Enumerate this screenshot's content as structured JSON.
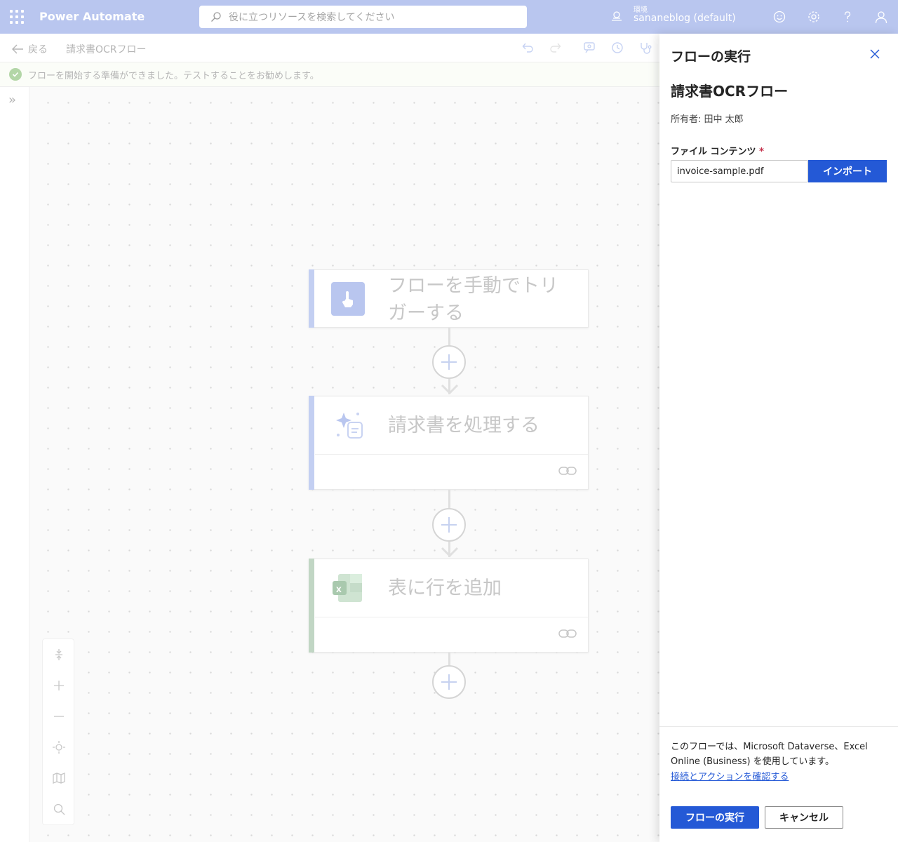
{
  "topbar": {
    "app_title": "Power Automate",
    "search_placeholder": "役に立つリソースを検索してください",
    "environment_label": "環境",
    "environment_name": "sananeblog (default)",
    "icons": [
      "waffle-icon",
      "search-icon",
      "environment-icon",
      "feedback-icon",
      "settings-icon",
      "help-icon",
      "account-icon"
    ]
  },
  "commandbar": {
    "back_label": "戻る",
    "flow_name": "請求書OCRフロー",
    "icons": [
      "undo-icon",
      "redo-icon",
      "copilot-icon",
      "history-icon",
      "flow-checker-icon"
    ]
  },
  "notice": {
    "text": "フローを開始する準備ができました。テストすることをお勧めします。"
  },
  "flow": {
    "steps": [
      {
        "title_line1": "フローを手動でトリ",
        "title_line2": "ガーする",
        "icon": "touch-trigger-icon",
        "accent": "#b9c6ef"
      },
      {
        "title": "請求書を処理する",
        "icon": "ai-document-icon",
        "accent": "#b9c6ef"
      },
      {
        "title": "表に行を追加",
        "icon": "excel-icon",
        "accent": "#b7d1bb"
      }
    ]
  },
  "zoombar": {
    "icons": [
      "fit-vertical-icon",
      "zoom-in-icon",
      "zoom-out-icon",
      "center-icon",
      "minimap-icon",
      "search-icon"
    ]
  },
  "panel": {
    "title": "フローの実行",
    "flow_name": "請求書OCRフロー",
    "owner": "所有者: 田中 太郎",
    "field_label": "ファイル コンテンツ",
    "required_mark": "*",
    "file_value": "invoice-sample.pdf",
    "import_label": "インポート",
    "footer_text": "このフローでは、Microsoft Dataverse、Excel Online (Business) を使用しています。",
    "footer_link": "接続とアクションを確認する",
    "run_label": "フローの実行",
    "cancel_label": "キャンセル"
  },
  "colors": {
    "topbar": "#b9c6ef",
    "primary": "#2459d6",
    "success": "#b3d6a7"
  }
}
